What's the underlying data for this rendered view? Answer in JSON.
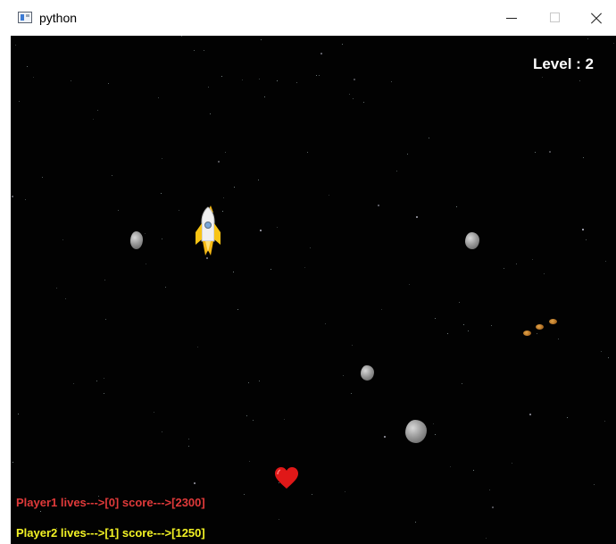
{
  "window": {
    "title": "python",
    "minimize_icon": "minimize-icon",
    "maximize_icon": "maximize-icon",
    "close_icon": "close-icon"
  },
  "hud": {
    "level_text": "Level : 2",
    "player1_text": "Player1 lives--->[0] score--->[2300]",
    "player2_text": "Player2 lives--->[1] score--->[1250]"
  },
  "sprites": {
    "ship_icon": "rocket-ship-icon",
    "asteroid_icon": "asteroid-icon",
    "bullet_icon": "bullet-icon",
    "heart_icon": "heart-icon"
  },
  "colors": {
    "background": "#020202",
    "player1": "#e03a3a",
    "player2": "#f3f325",
    "level": "#ffffff"
  }
}
